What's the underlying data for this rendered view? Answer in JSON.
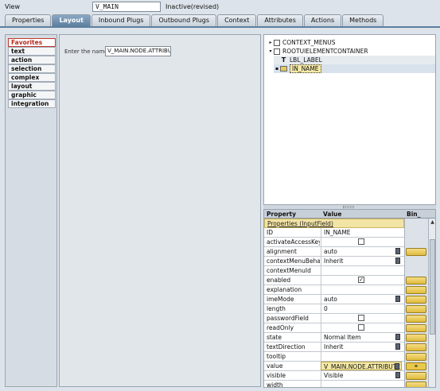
{
  "header": {
    "view_label": "View",
    "view_name": "V_MAIN",
    "status": "Inactive(revised)"
  },
  "tabs": [
    {
      "label": "Properties"
    },
    {
      "label": "Layout",
      "active": true
    },
    {
      "label": "Inbound Plugs"
    },
    {
      "label": "Outbound Plugs"
    },
    {
      "label": "Context"
    },
    {
      "label": "Attributes"
    },
    {
      "label": "Actions"
    },
    {
      "label": "Methods"
    }
  ],
  "palette": {
    "items": [
      "Favorites",
      "text",
      "action",
      "selection",
      "complex",
      "layout",
      "graphic",
      "integration"
    ],
    "selected": "Favorites"
  },
  "canvas": {
    "name_label": "Enter the name:",
    "name_value": "V_MAIN.NODE.ATTRIBUTE"
  },
  "tree": {
    "nodes": [
      {
        "label": "CONTEXT_MENUS",
        "toggle": "▸",
        "icon": "checkbox"
      },
      {
        "label": "ROOTUIELEMENTCONTAINER",
        "toggle": "▾",
        "icon": "checkbox"
      },
      {
        "label": "LBL_LABEL",
        "toggle": "",
        "icon": "T"
      },
      {
        "label": "IN_NAME",
        "toggle": "▪",
        "icon": "input-field",
        "selected": true
      }
    ]
  },
  "properties": {
    "headers": {
      "property": "Property",
      "value": "Value",
      "binding": "Bin_"
    },
    "group": "Properties (InputField)",
    "rows": [
      {
        "name": "ID",
        "value": "IN_NAME",
        "kind": "text"
      },
      {
        "name": "activateAccessKey",
        "value": "",
        "kind": "checkbox"
      },
      {
        "name": "alignment",
        "value": "auto",
        "kind": "dropdown",
        "bind": true
      },
      {
        "name": "contextMenuBehav",
        "value": "Inherit",
        "kind": "dropdown"
      },
      {
        "name": "contextMenuId",
        "value": "",
        "kind": "text"
      },
      {
        "name": "enabled",
        "value": "✓",
        "kind": "checkbox",
        "bind": true
      },
      {
        "name": "explanation",
        "value": "",
        "kind": "text",
        "bind": true
      },
      {
        "name": "imeMode",
        "value": "auto",
        "kind": "dropdown",
        "bind": true
      },
      {
        "name": "length",
        "value": "0",
        "kind": "text",
        "bind": true
      },
      {
        "name": "passwordField",
        "value": "",
        "kind": "checkbox",
        "bind": true
      },
      {
        "name": "readOnly",
        "value": "",
        "kind": "checkbox",
        "bind": true
      },
      {
        "name": "state",
        "value": "Normal Item",
        "kind": "dropdown",
        "bind": true
      },
      {
        "name": "textDirection",
        "value": "Inherit",
        "kind": "dropdown",
        "bind": true
      },
      {
        "name": "tooltip",
        "value": "",
        "kind": "text",
        "bind": true
      },
      {
        "name": "value",
        "value": "V_MAIN.NODE.ATTRIBUTE",
        "kind": "highlight",
        "bind": "link"
      },
      {
        "name": "visible",
        "value": "Visible",
        "kind": "dropdown",
        "bind": true
      },
      {
        "name": "width",
        "value": "",
        "kind": "text",
        "bind": true
      }
    ]
  }
}
